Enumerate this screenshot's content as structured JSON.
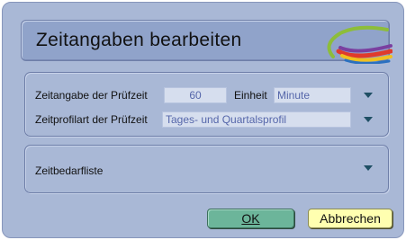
{
  "dialog": {
    "title": "Zeitangaben bearbeiten"
  },
  "pruefzeit": {
    "label": "Zeitangabe der Prüfzeit",
    "value": "60",
    "unit_label": "Einheit",
    "unit_value": "Minute"
  },
  "zeitprofil": {
    "label": "Zeitprofilart der Prüfzeit",
    "value": "Tages- und Quartalsprofil"
  },
  "zeitbedarf": {
    "label": "Zeitbedarfliste"
  },
  "buttons": {
    "ok_label": "OK",
    "cancel_label": "Abbrechen"
  },
  "colors": {
    "dialog_bg": "#a9b8d6",
    "field_bg": "#d6deee",
    "ok_button": "#6cb59a",
    "cancel_button": "#ffffb0",
    "dropdown_arrow": "#1f4f64"
  },
  "icons": {
    "logo": "swoosh-logo",
    "dropdown": "triangle-down"
  }
}
